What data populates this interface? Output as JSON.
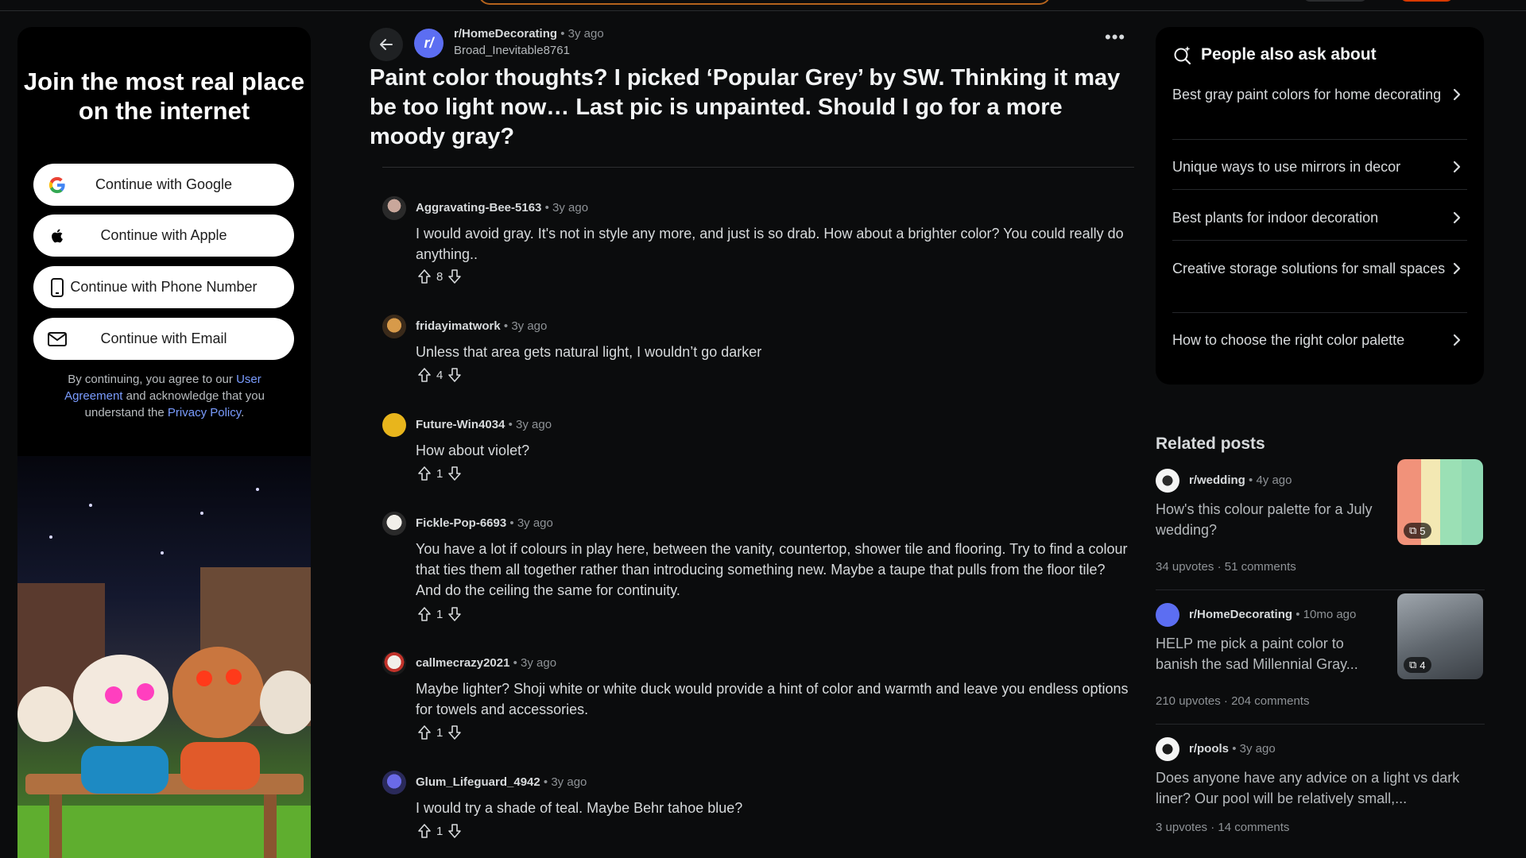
{
  "colors": {
    "bg": "#0b0c0d",
    "accent_link": "#7a9cff",
    "sub_avatar": "#5c6ef2",
    "reddit_orange": "#d93900"
  },
  "signup": {
    "heading": "Join the most real place on the internet",
    "google_label": "Continue with Google",
    "apple_label": "Continue with Apple",
    "phone_label": "Continue with Phone Number",
    "email_label": "Continue with Email",
    "legal_1": "By continuing, you agree to our ",
    "legal_link_1": "User Agreement",
    "legal_2": " and acknowledge that you understand the ",
    "legal_link_2": "Privacy Policy",
    "legal_3": "."
  },
  "post": {
    "subreddit": "r/HomeDecorating",
    "sep": "•",
    "age": "3y ago",
    "author": "Broad_Inevitable8761",
    "title": "Paint color thoughts? I picked ‘Popular Grey’ by SW. Thinking it may be too light now… Last pic is unpainted. Should I go for a more moody gray?",
    "sub_avatar_letter": "r/"
  },
  "comments": [
    {
      "user": "Aggravating-Bee-5163",
      "age": "3y ago",
      "text": "I would avoid gray. It's not in style any more, and just is so drab. How about a brighter color? You could really do anything..",
      "score": "8"
    },
    {
      "user": "fridayimatwork",
      "age": "3y ago",
      "text": "Unless that area gets natural light, I wouldn’t go darker",
      "score": "4"
    },
    {
      "user": "Future-Win4034",
      "age": "3y ago",
      "text": "How about violet?",
      "score": "1"
    },
    {
      "user": "Fickle-Pop-6693",
      "age": "3y ago",
      "text": "You have a lot if colours in play here, between the vanity, countertop, shower tile and flooring. Try to find a colour that ties them all together rather than introducing something new. Maybe a taupe that pulls from the floor tile? And do the ceiling the same for continuity.",
      "score": "1"
    },
    {
      "user": "callmecrazy2021",
      "age": "3y ago",
      "text": "Maybe lighter? Shoji white or white duck would provide a hint of color and warmth and leave you endless options for towels and accessories.",
      "score": "1"
    },
    {
      "user": "Glum_Lifeguard_4942",
      "age": "3y ago",
      "text": "I would try a shade of teal. Maybe Behr tahoe blue?",
      "score": "1"
    }
  ],
  "people_also_ask": {
    "heading": "People also ask about",
    "items": [
      "Best gray paint colors for home decorating",
      "Unique ways to use mirrors in decor",
      "Best plants for indoor decoration",
      "Creative storage solutions for small spaces",
      "How to choose the right color palette"
    ]
  },
  "related": {
    "heading": "Related posts",
    "posts": [
      {
        "sub": "r/wedding",
        "age": "4y ago",
        "title": "How's this colour palette for a July wedding?",
        "upvotes": "34 upvotes",
        "comments": "51 comments",
        "gallery_count": "5"
      },
      {
        "sub": "r/HomeDecorating",
        "age": "10mo ago",
        "title": "HELP me pick a paint color to banish the sad Millennial Gray...",
        "upvotes": "210 upvotes",
        "comments": "204 comments",
        "gallery_count": "4"
      },
      {
        "sub": "r/pools",
        "age": "3y ago",
        "title": "Does anyone have any advice on a light vs dark liner? Our pool will be relatively small,...",
        "upvotes": "3 upvotes",
        "comments": "14 comments"
      }
    ],
    "stat_sep": "·"
  }
}
